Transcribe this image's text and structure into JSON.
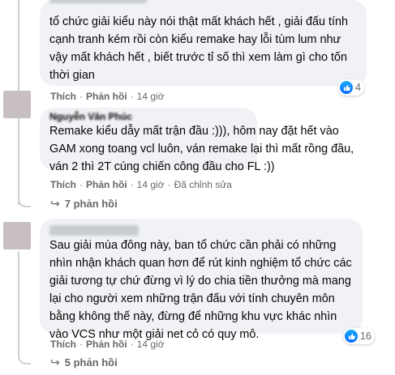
{
  "comments": [
    {
      "text": "tổ chức giải kiểu này nói thật mất khách hết , giải đấu tính cạnh tranh kém rồi còn kiểu remake hay lỗi tùm lum như vậy mất khách hết , biết trước tỉ số thì xem làm gì cho tốn thời gian",
      "like_label": "Thích",
      "reply_label": "Phản hồi",
      "time": "14 giờ",
      "reaction_count": "4"
    },
    {
      "author": "Nguyễn Văn Phúc",
      "text": "Remake kiểu dẫy mất trận đầu :))), hôm nay đặt hết vào GAM xong toang vcl luôn, ván remake lại thì mất rồng đầu, ván 2 thì 2T cúng chiến công đầu cho FL :))",
      "like_label": "Thích",
      "reply_label": "Phản hồi",
      "time": "14 giờ",
      "edited": "Đã chỉnh sửa",
      "replies_label": "7 phản hồi"
    },
    {
      "text": "Sau giải mùa đông này, ban tổ chức cần phải có những nhìn nhận khách quan hơn để rút kinh nghiệm tổ chức các giải tương tự chứ đừng vì lý do chia tiền thưởng mà mang lại cho người xem những trận đấu với tính chuyên môn bằng không thế này, đừng để những khu vực khác nhìn vào VCS như một giải net cỏ có quy mô.",
      "like_label": "Thích",
      "reply_label": "Phản hồi",
      "time": "14 giờ",
      "reaction_count": "16",
      "replies_label": "5 phản hồi"
    }
  ],
  "icons": {
    "like": "like-icon",
    "reply_arrow": "reply-arrow-icon"
  },
  "colors": {
    "bubble": "#f0f2f5",
    "meta": "#65676b",
    "like": "#0866ff"
  }
}
